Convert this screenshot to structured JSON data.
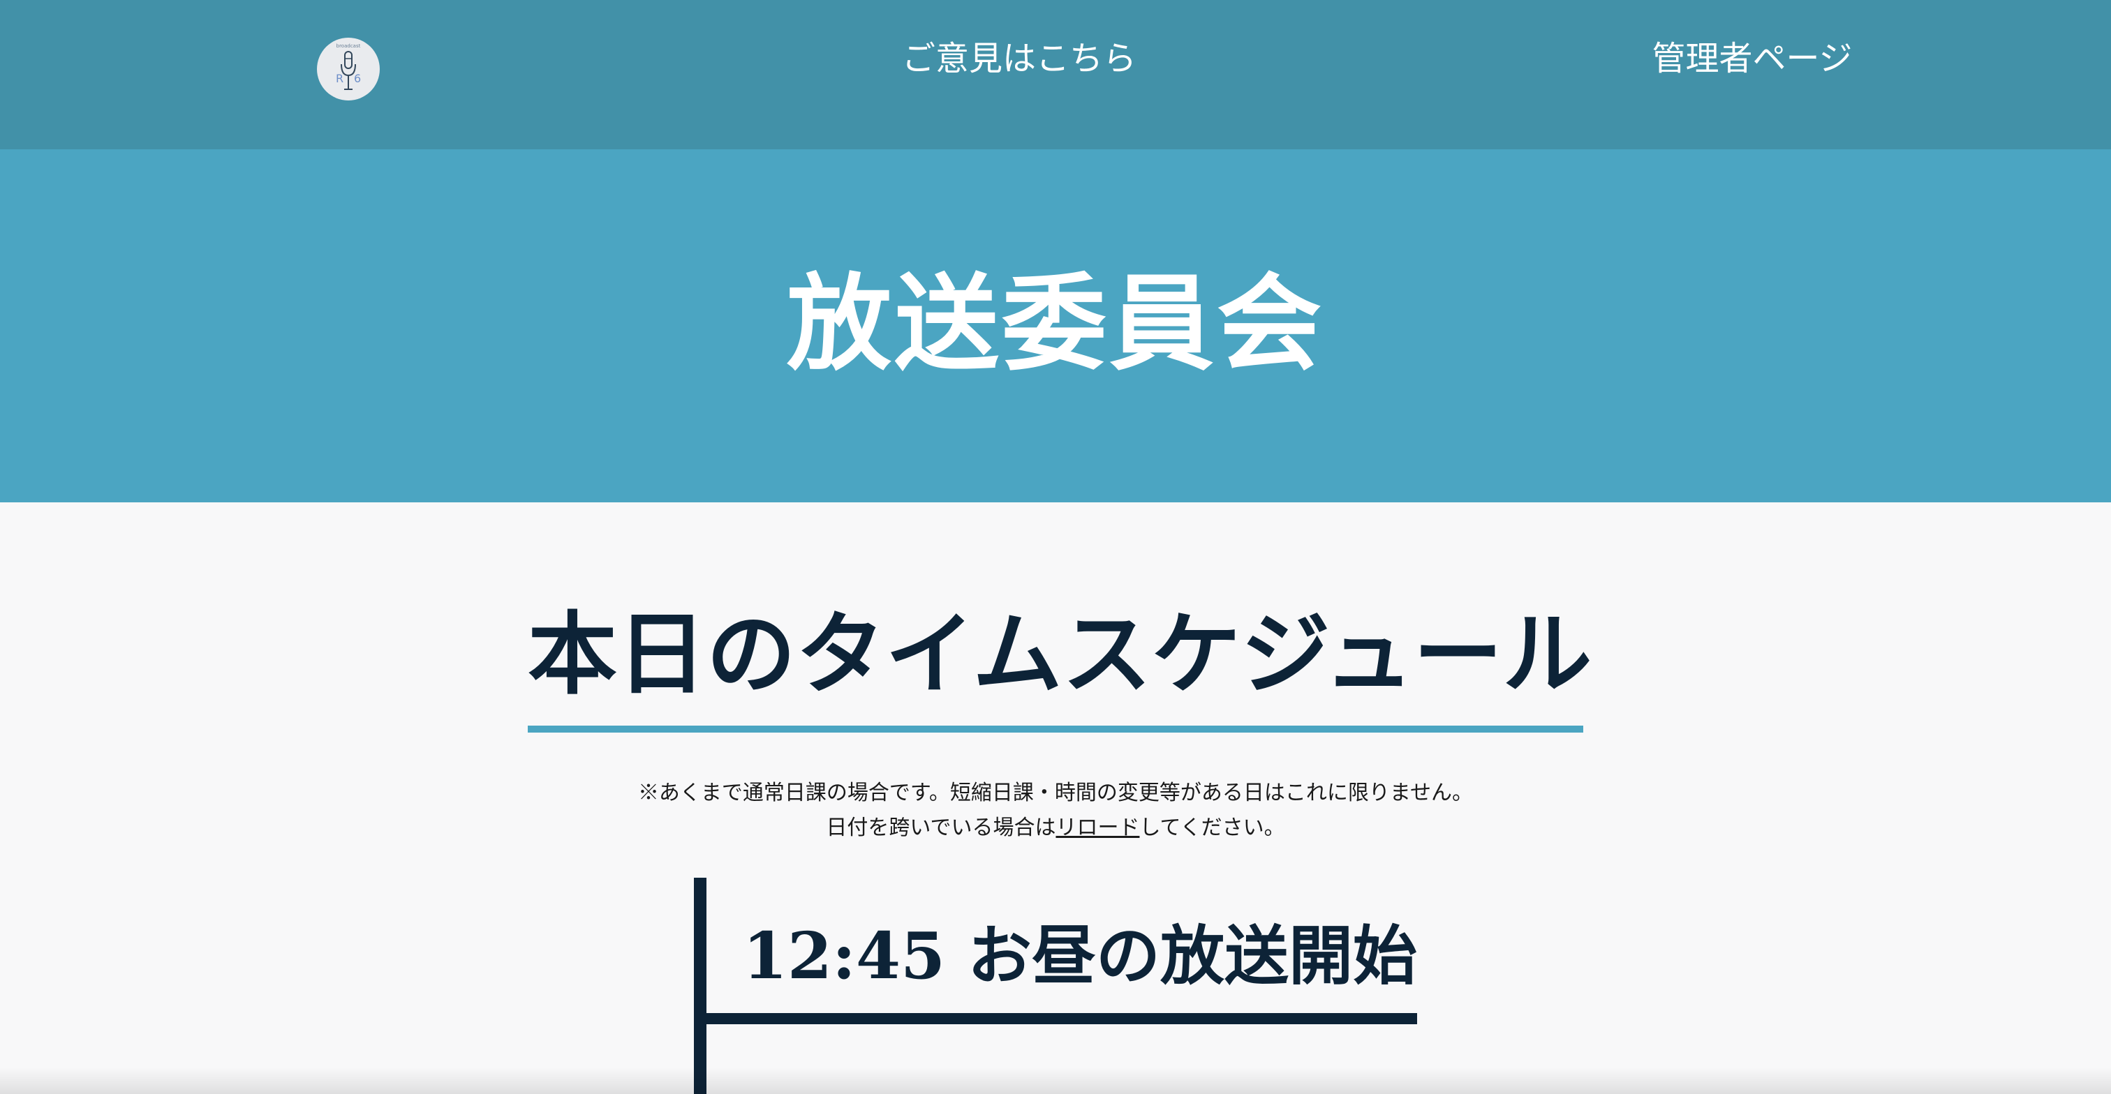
{
  "navbar": {
    "logo_text": "broadcast",
    "logo_letters": [
      "R",
      "6"
    ],
    "opinion_link": "ご意見はこちら",
    "admin_link": "管理者ページ"
  },
  "hero": {
    "title": "放送委員会"
  },
  "schedule": {
    "title": "本日のタイムスケジュール",
    "notice_line1": "※あくまで通常日課の場合です。短縮日課・時間の変更等がある日はこれに限りません。",
    "notice_line2_before": "日付を跨いでいる場合は",
    "notice_line2_link": "リロード",
    "notice_line2_after": "してください。",
    "events": [
      {
        "time": "12:45",
        "label": "お昼の放送開始"
      }
    ]
  },
  "colors": {
    "navbar": "#4291a8",
    "hero": "#4ba5c2",
    "accent": "#4ba5c2",
    "text_dark": "#0d2337",
    "background": "#f8f8f9"
  }
}
